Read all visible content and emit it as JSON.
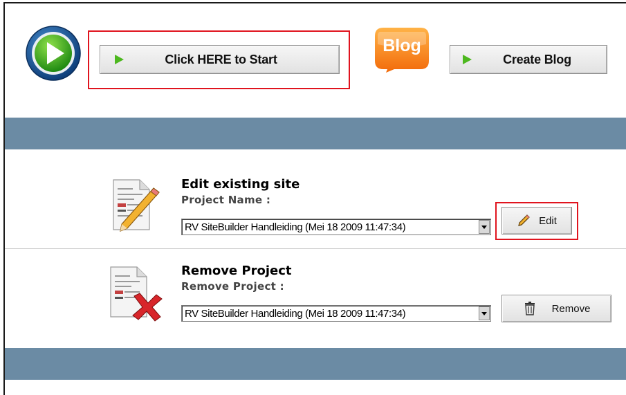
{
  "toolbar": {
    "start_label": "Click HERE to Start",
    "blog_logo_text": "Blog",
    "create_blog_label": "Create Blog"
  },
  "edit_section": {
    "title": "Edit existing site",
    "subtitle": "Project Name :",
    "selected_project": "RV SiteBuilder Handleiding (Mei 18 2009 11:47:34)",
    "edit_label": "Edit"
  },
  "remove_section": {
    "title": "Remove Project",
    "subtitle": "Remove Project :",
    "selected_project": "RV SiteBuilder Handleiding (Mei 18 2009 11:47:34)",
    "remove_label": "Remove"
  },
  "colors": {
    "band": "#6b8ba4",
    "highlight": "#e0141e",
    "play_green": "#4db81f",
    "blog_orange": "#f7941d"
  },
  "icons": [
    "play-circle-icon",
    "play-triangle-icon",
    "blog-logo-icon",
    "edit-document-icon",
    "pencil-icon",
    "remove-document-icon",
    "trash-icon",
    "dropdown-arrow-icon"
  ]
}
